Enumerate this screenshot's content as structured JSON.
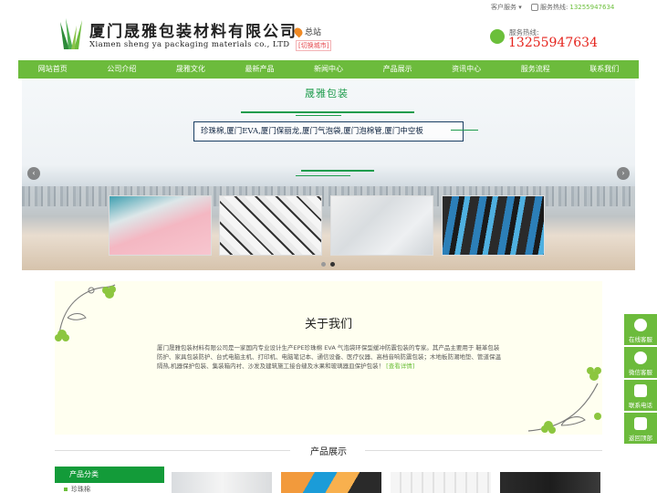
{
  "top": {
    "service_label": "客户服务 ▾",
    "hotline_label": "服务热线:",
    "hotline_number": "13255947634"
  },
  "header": {
    "company_cn": "厦门晟雅包装材料有限公司",
    "company_en": "Xiamen sheng ya packaging materials co., LTD",
    "city": "总站",
    "switch_city": "[切换城市]",
    "hotline_label": "服务热线:",
    "hotline_number": "13255947634"
  },
  "nav": [
    {
      "label": "网站首页"
    },
    {
      "label": "公司介绍"
    },
    {
      "label": "晟雅文化"
    },
    {
      "label": "最新产品"
    },
    {
      "label": "新闻中心"
    },
    {
      "label": "产品展示"
    },
    {
      "label": "资讯中心"
    },
    {
      "label": "服务流程"
    },
    {
      "label": "联系我们"
    }
  ],
  "banner": {
    "brand": "晟雅包装",
    "tagline": "珍珠棉,厦门EVA,厦门保丽龙,厦门气泡袋,厦门泡棉管,厦门中空板",
    "prev": "‹",
    "next": "›"
  },
  "about": {
    "title": "关于我们",
    "text": "厦门晟雅包装材料有限公司是一家国内专业设计生产EPE珍珠棉 EVA 气泡袋环保型缓冲防震包装的专家。其产品主要用于 鞋革包装防护、家具包装防护、台式电脑主机、打印机、电脑笔记本、通信设备、医疗仪器、高档音响防震包装；木地板防潮地垫、管道保温隔热,机器保护包装、集装箱内衬、沙发及建筑施工接合缝及水果和玻璃器皿保护包装！",
    "more": "[查看详情]"
  },
  "products": {
    "title": "产品展示",
    "category_title": "产品分类",
    "categories": [
      {
        "label": "珍珠棉"
      }
    ]
  },
  "side": [
    {
      "label": "在线客服"
    },
    {
      "label": "微信客服"
    },
    {
      "label": "联系电话"
    },
    {
      "label": "返回顶部"
    }
  ],
  "colors": {
    "brand_green": "#6cbb3c",
    "category_green": "#139b39",
    "hotline_red": "#e5231c"
  }
}
